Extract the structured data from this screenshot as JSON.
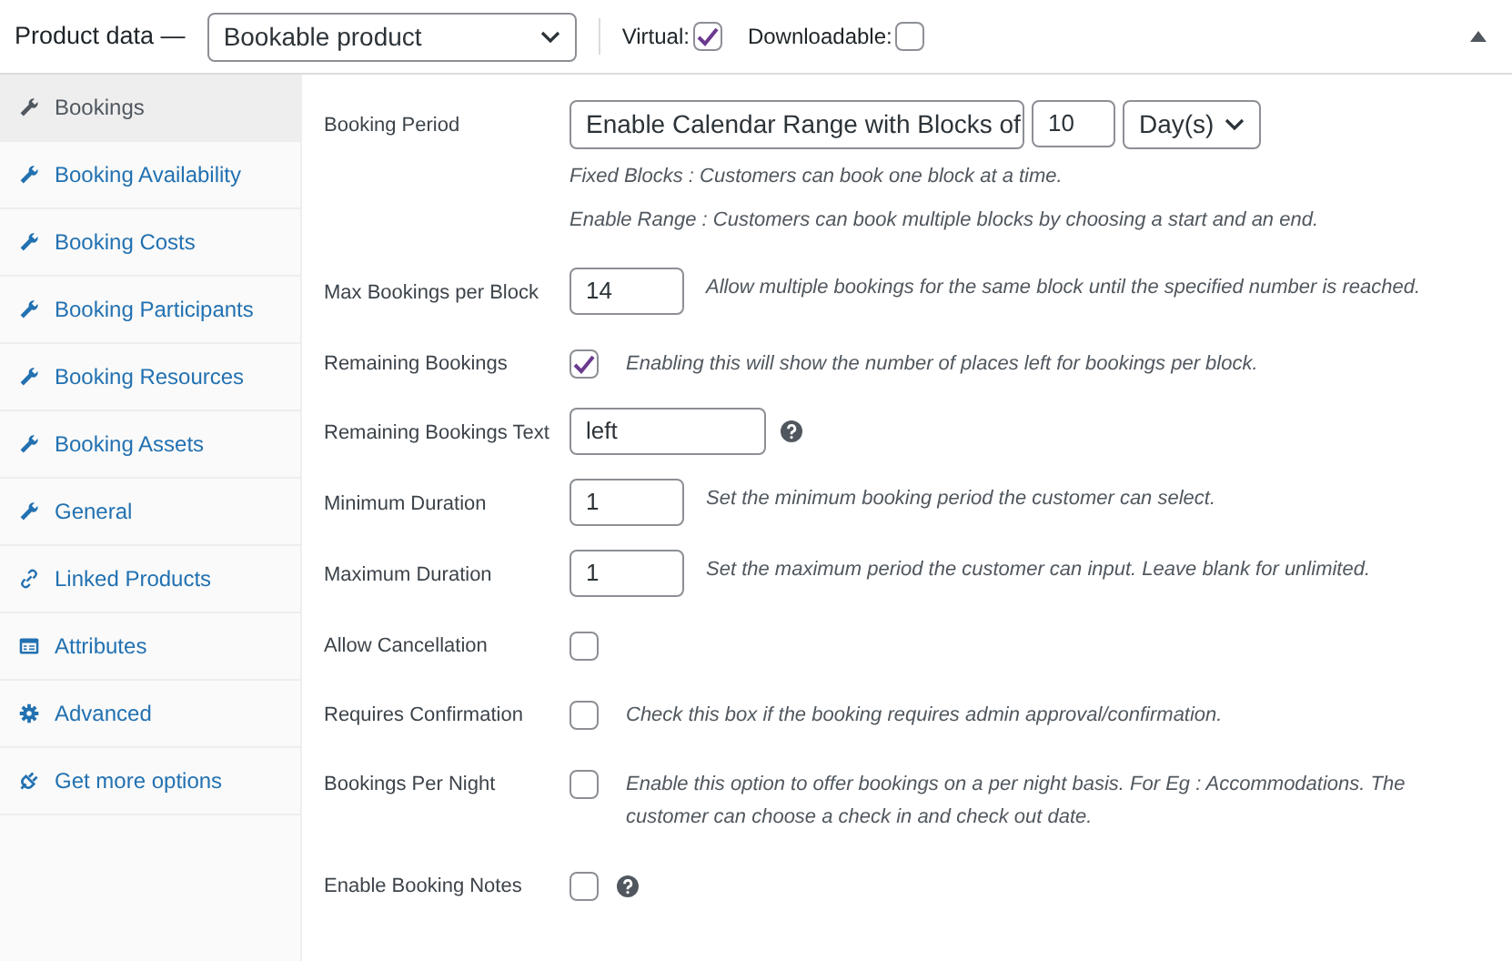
{
  "header": {
    "title": "Product data —",
    "product_type": "Bookable product",
    "options": [
      {
        "label": "Virtual:",
        "checked": true
      },
      {
        "label": "Downloadable:",
        "checked": false
      }
    ]
  },
  "sidebar": {
    "items": [
      {
        "label": "Bookings",
        "kind": "wrench",
        "selected": true
      },
      {
        "label": "Booking Availability",
        "kind": "wrench",
        "selected": false
      },
      {
        "label": "Booking Costs",
        "kind": "wrench",
        "selected": false
      },
      {
        "label": "Booking Participants",
        "kind": "wrench",
        "selected": false
      },
      {
        "label": "Booking Resources",
        "kind": "wrench",
        "selected": false
      },
      {
        "label": "Booking Assets",
        "kind": "wrench",
        "selected": false
      },
      {
        "label": "General",
        "kind": "wrench",
        "selected": false
      },
      {
        "label": "Linked Products",
        "kind": "link",
        "selected": false
      },
      {
        "label": "Attributes",
        "kind": "card",
        "selected": false
      },
      {
        "label": "Advanced",
        "kind": "gear",
        "selected": false
      },
      {
        "label": "Get more options",
        "kind": "plug",
        "selected": false
      }
    ]
  },
  "fields": [
    {
      "kind": "period",
      "label": "Booking Period",
      "mode": "Enable Calendar Range with Blocks of",
      "amount": "10",
      "unit": "Day(s)",
      "notes": [
        "Fixed Blocks : Customers can book one block at a time.",
        "Enable Range : Customers can book multiple blocks by choosing a start and an end."
      ]
    },
    {
      "kind": "number",
      "label": "Max Bookings per Block",
      "value": "14",
      "description": "Allow multiple bookings for the same block until the specified number is reached."
    },
    {
      "kind": "checkbox",
      "label": "Remaining Bookings",
      "checked": true,
      "description": "Enabling this will show the number of places left for bookings per block."
    },
    {
      "kind": "text",
      "label": "Remaining Bookings Text",
      "value": "left",
      "help": true
    },
    {
      "kind": "number",
      "label": "Minimum Duration",
      "value": "1",
      "description": "Set the minimum booking period the customer can select."
    },
    {
      "kind": "number",
      "label": "Maximum Duration",
      "value": "1",
      "description": "Set the maximum period the customer can input. Leave blank for unlimited."
    },
    {
      "kind": "checkbox",
      "label": "Allow Cancellation",
      "checked": false
    },
    {
      "kind": "checkbox",
      "label": "Requires Confirmation",
      "checked": false,
      "description": "Check this box if the booking requires admin approval/confirmation."
    },
    {
      "kind": "checkbox",
      "label": "Bookings Per Night",
      "checked": false,
      "description": "Enable this option to offer bookings on a per night basis. For Eg : Accommodations. The customer can choose a check in and check out date."
    },
    {
      "kind": "checkbox",
      "label": "Enable Booking Notes",
      "checked": false,
      "help": true
    }
  ]
}
